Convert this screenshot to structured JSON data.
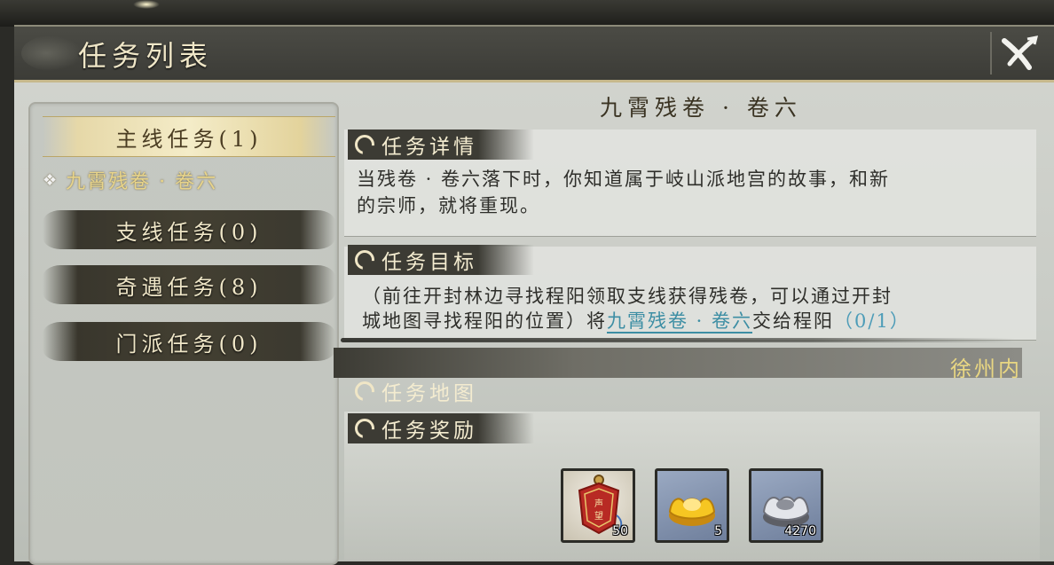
{
  "window": {
    "title": "任务列表"
  },
  "categories": [
    {
      "label": "主线任务(1)",
      "state": "active"
    },
    {
      "label": "支线任务(0)",
      "state": "normal"
    },
    {
      "label": "奇遇任务(8)",
      "state": "normal"
    },
    {
      "label": "门派任务(0)",
      "state": "normal"
    }
  ],
  "selected_quest_item": "九霄残卷 · 卷六",
  "quest": {
    "title": "九霄残卷 · 卷六",
    "details_heading": "任务详情",
    "details_line1": "当残卷 · 卷六落下时，你知道属于岐山派地宫的故事，和新",
    "details_line2": "的宗师，就将重现。",
    "objective_heading": "任务目标",
    "objective_line1": "（前往开封林边寻找程阳领取支线获得残卷，可以通过开封",
    "objective_line2_prefix": "城地图寻找程阳的位置）将",
    "objective_link": "九霄残卷 · 卷六",
    "objective_line2_suffix": "交给程阳",
    "objective_progress": "（0/1）",
    "map_heading": "任务地图",
    "map_value": "徐州内",
    "reward_heading": "任务奖励"
  },
  "rewards": [
    {
      "icon": "reputation-token-icon",
      "count": "50",
      "token_text": "声望"
    },
    {
      "icon": "gold-ingot-icon",
      "count": "5"
    },
    {
      "icon": "silver-ingot-icon",
      "count": "4270"
    }
  ],
  "colors": {
    "accent_gold": "#e9d782",
    "link_teal": "#3d8ea4"
  }
}
